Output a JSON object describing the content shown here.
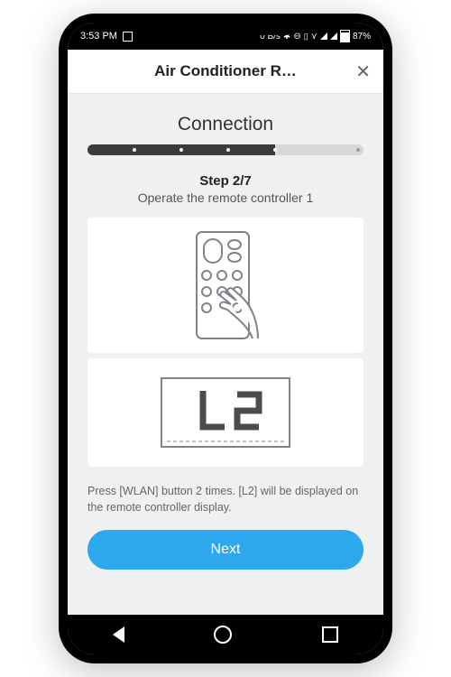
{
  "status": {
    "time": "3:53 PM",
    "data_rate": "0 B/s",
    "battery": "87%"
  },
  "header": {
    "title": "Air Conditioner R…"
  },
  "page": {
    "section_title": "Connection",
    "progress_total_steps": 7,
    "progress_current_step": 2,
    "step_label": "Step 2/7",
    "step_subtitle": "Operate the remote controller 1",
    "display_code": "L2",
    "instruction": "Press [WLAN] button 2 times. [L2] will be displayed on the remote controller display.",
    "next_label": "Next"
  }
}
